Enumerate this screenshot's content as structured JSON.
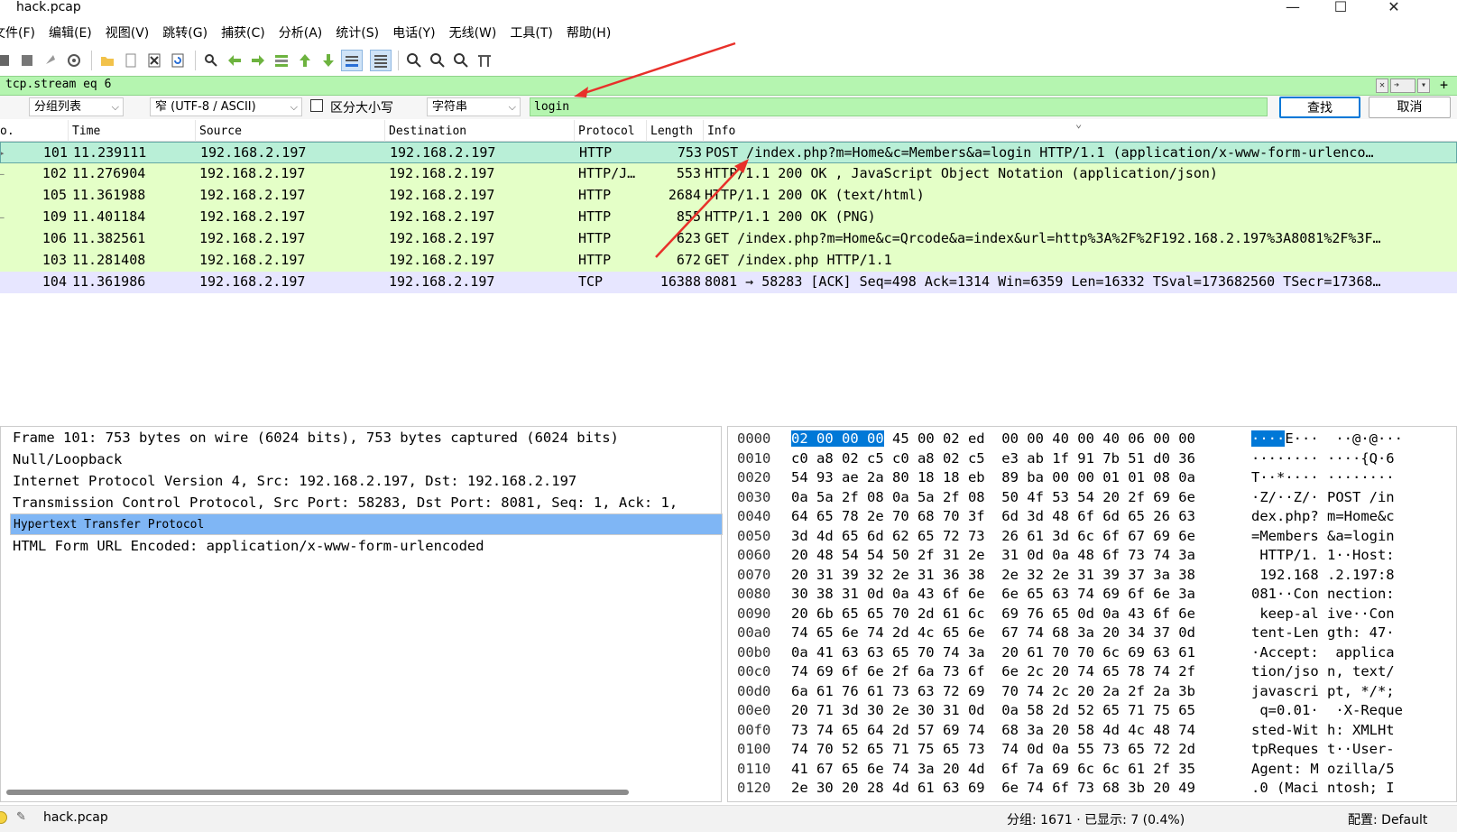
{
  "window": {
    "title": "hack.pcap",
    "min": "—",
    "max": "☐",
    "close": "✕"
  },
  "menu": [
    "文件(F)",
    "编辑(E)",
    "视图(V)",
    "跳转(G)",
    "捕获(C)",
    "分析(A)",
    "统计(S)",
    "电话(Y)",
    "无线(W)",
    "工具(T)",
    "帮助(H)"
  ],
  "toolbar_icons": [
    "start-capture-icon",
    "stop-capture-icon",
    "restart-capture-icon",
    "capture-options-icon",
    "open-file-icon",
    "save-file-icon",
    "close-file-icon",
    "reload-file-icon",
    "find-packet-icon",
    "go-back-icon",
    "go-forward-icon",
    "go-to-packet-icon",
    "go-first-icon",
    "go-last-icon",
    "auto-scroll-icon",
    "colorize-icon",
    "zoom-in-icon",
    "zoom-out-icon",
    "normal-size-icon",
    "resize-columns-icon"
  ],
  "filter": {
    "value": "tcp.stream eq 6",
    "clear": "✕",
    "apply": "➔",
    "dropdown": "▾",
    "add": "+"
  },
  "find": {
    "scope": "分组列表",
    "encoding": "窄 (UTF-8 / ASCII)",
    "case_label": "区分大小写",
    "type": "字符串",
    "value": "login",
    "find_button": "查找",
    "cancel_button": "取消"
  },
  "packet_list": {
    "columns": [
      "o.",
      "Time",
      "Source",
      "Destination",
      "Protocol",
      "Length",
      "Info"
    ],
    "rows": [
      {
        "no": "101",
        "time": "11.239111",
        "src": "192.168.2.197",
        "dst": "192.168.2.197",
        "proto": "HTTP",
        "len": "753",
        "info": "POST /index.php?m=Home&c=Members&a=login HTTP/1.1  (application/x-www-form-urlenco…",
        "marker": "▸"
      },
      {
        "no": "102",
        "time": "11.276904",
        "src": "192.168.2.197",
        "dst": "192.168.2.197",
        "proto": "HTTP/J…",
        "len": "553",
        "info": "HTTP/1.1 200 OK , JavaScript Object Notation (application/json)",
        "marker": "–"
      },
      {
        "no": "105",
        "time": "11.361988",
        "src": "192.168.2.197",
        "dst": "192.168.2.197",
        "proto": "HTTP",
        "len": "2684",
        "info": "HTTP/1.1 200 OK  (text/html)",
        "marker": ""
      },
      {
        "no": "109",
        "time": "11.401184",
        "src": "192.168.2.197",
        "dst": "192.168.2.197",
        "proto": "HTTP",
        "len": "855",
        "info": "HTTP/1.1 200 OK  (PNG)",
        "marker": "–"
      },
      {
        "no": "106",
        "time": "11.382561",
        "src": "192.168.2.197",
        "dst": "192.168.2.197",
        "proto": "HTTP",
        "len": "623",
        "info": "GET /index.php?m=Home&c=Qrcode&a=index&url=http%3A%2F%2F192.168.2.197%3A8081%2F%3F…",
        "marker": ""
      },
      {
        "no": "103",
        "time": "11.281408",
        "src": "192.168.2.197",
        "dst": "192.168.2.197",
        "proto": "HTTP",
        "len": "672",
        "info": "GET /index.php HTTP/1.1",
        "marker": ""
      },
      {
        "no": "104",
        "time": "11.361986",
        "src": "192.168.2.197",
        "dst": "192.168.2.197",
        "proto": "TCP",
        "len": "16388",
        "info": "8081 → 58283 [ACK] Seq=498 Ack=1314 Win=6359 Len=16332 TSval=173682560 TSecr=17368…",
        "marker": ""
      }
    ]
  },
  "details": [
    "Frame 101: 753 bytes on wire (6024 bits), 753 bytes captured (6024 bits)",
    "Null/Loopback",
    "Internet Protocol Version 4, Src: 192.168.2.197, Dst: 192.168.2.197",
    "Transmission Control Protocol, Src Port: 58283, Dst Port: 8081, Seq: 1, Ack: 1,",
    "Hypertext Transfer Protocol",
    "HTML Form URL Encoded: application/x-www-form-urlencoded"
  ],
  "hex": [
    {
      "off": "0000",
      "hl": "02 00 00 00",
      "hex": " 45 00 02 ed  00 00 40 00 40 06 00 00",
      "ahl": "····",
      "asc": "E···  ··@·@···"
    },
    {
      "off": "0010",
      "hex": "c0 a8 02 c5 c0 a8 02 c5  e3 ab 1f 91 7b 51 d0 36",
      "asc": "········ ····{Q·6"
    },
    {
      "off": "0020",
      "hex": "54 93 ae 2a 80 18 18 eb  89 ba 00 00 01 01 08 0a",
      "asc": "T··*···· ········"
    },
    {
      "off": "0030",
      "hex": "0a 5a 2f 08 0a 5a 2f 08  50 4f 53 54 20 2f 69 6e",
      "asc": "·Z/··Z/· POST /in"
    },
    {
      "off": "0040",
      "hex": "64 65 78 2e 70 68 70 3f  6d 3d 48 6f 6d 65 26 63",
      "asc": "dex.php? m=Home&c"
    },
    {
      "off": "0050",
      "hex": "3d 4d 65 6d 62 65 72 73  26 61 3d 6c 6f 67 69 6e",
      "asc": "=Members &a=login"
    },
    {
      "off": "0060",
      "hex": "20 48 54 54 50 2f 31 2e  31 0d 0a 48 6f 73 74 3a",
      "asc": " HTTP/1. 1··Host:"
    },
    {
      "off": "0070",
      "hex": "20 31 39 32 2e 31 36 38  2e 32 2e 31 39 37 3a 38",
      "asc": " 192.168 .2.197:8"
    },
    {
      "off": "0080",
      "hex": "30 38 31 0d 0a 43 6f 6e  6e 65 63 74 69 6f 6e 3a",
      "asc": "081··Con nection:"
    },
    {
      "off": "0090",
      "hex": "20 6b 65 65 70 2d 61 6c  69 76 65 0d 0a 43 6f 6e",
      "asc": " keep-al ive··Con"
    },
    {
      "off": "00a0",
      "hex": "74 65 6e 74 2d 4c 65 6e  67 74 68 3a 20 34 37 0d",
      "asc": "tent-Len gth: 47·"
    },
    {
      "off": "00b0",
      "hex": "0a 41 63 63 65 70 74 3a  20 61 70 70 6c 69 63 61",
      "asc": "·Accept:  applica"
    },
    {
      "off": "00c0",
      "hex": "74 69 6f 6e 2f 6a 73 6f  6e 2c 20 74 65 78 74 2f",
      "asc": "tion/jso n, text/"
    },
    {
      "off": "00d0",
      "hex": "6a 61 76 61 73 63 72 69  70 74 2c 20 2a 2f 2a 3b",
      "asc": "javascri pt, */*;"
    },
    {
      "off": "00e0",
      "hex": "20 71 3d 30 2e 30 31 0d  0a 58 2d 52 65 71 75 65",
      "asc": " q=0.01·  ·X-Reque"
    },
    {
      "off": "00f0",
      "hex": "73 74 65 64 2d 57 69 74  68 3a 20 58 4d 4c 48 74",
      "asc": "sted-Wit h: XMLHt"
    },
    {
      "off": "0100",
      "hex": "74 70 52 65 71 75 65 73  74 0d 0a 55 73 65 72 2d",
      "asc": "tpReques t··User-"
    },
    {
      "off": "0110",
      "hex": "41 67 65 6e 74 3a 20 4d  6f 7a 69 6c 6c 61 2f 35",
      "asc": "Agent: M ozilla/5"
    },
    {
      "off": "0120",
      "hex": "2e 30 20 28 4d 61 63 69  6e 74 6f 73 68 3b 20 49",
      "asc": ".0 (Maci ntosh; I"
    }
  ],
  "status": {
    "file": "hack.pcap",
    "packets": "分组: 1671 · 已显示: 7 (0.4%)",
    "profile": "配置: Default"
  },
  "colors": {
    "filter_ok": "#b5f5b0",
    "http_row": "#e4ffc7",
    "tcp_row": "#e7e6ff",
    "selected_row": "#b9efd7",
    "selected_detail": "#7fb6f5",
    "annotation_arrow": "#e8302a"
  }
}
